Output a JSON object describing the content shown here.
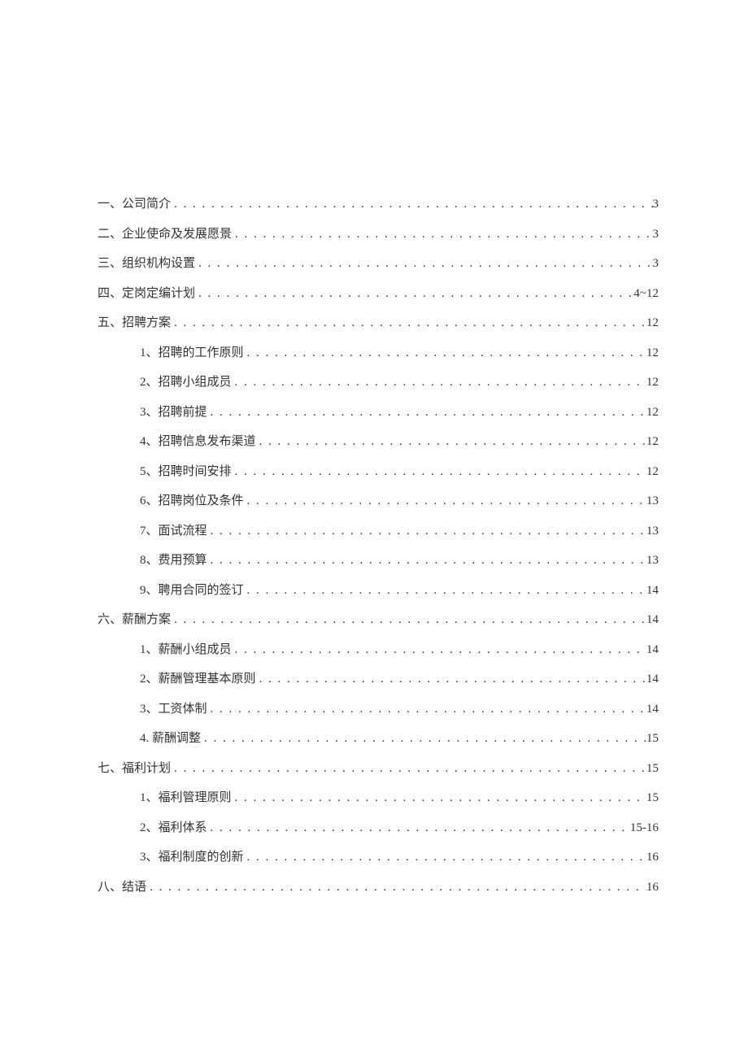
{
  "toc": [
    {
      "level": 1,
      "label": "一、公司简介",
      "page": "3"
    },
    {
      "level": 1,
      "label": "二、企业使命及发展愿景",
      "page": "3"
    },
    {
      "level": 1,
      "label": "三、组织机构设置",
      "page": "3"
    },
    {
      "level": 1,
      "label": "四、定岗定编计划",
      "page": "4~12"
    },
    {
      "level": 1,
      "label": "五、招聘方案",
      "page": "12"
    },
    {
      "level": 2,
      "label": "1、招聘的工作原则",
      "page": "12"
    },
    {
      "level": 2,
      "label": "2、招聘小组成员",
      "page": "12"
    },
    {
      "level": 2,
      "label": "3、招聘前提",
      "page": "12"
    },
    {
      "level": 2,
      "label": "4、招聘信息发布渠道",
      "page": "12"
    },
    {
      "level": 2,
      "label": "5、招聘时间安排",
      "page": "12"
    },
    {
      "level": 2,
      "label": "6、招聘岗位及条件",
      "page": "13"
    },
    {
      "level": 2,
      "label": "7、面试流程",
      "page": "13"
    },
    {
      "level": 2,
      "label": "8、费用预算",
      "page": "13"
    },
    {
      "level": 2,
      "label": "9、聘用合同的签订",
      "page": "14"
    },
    {
      "level": 1,
      "label": "六、薪酬方案",
      "page": "14"
    },
    {
      "level": 2,
      "label": "1、薪酬小组成员",
      "page": "14"
    },
    {
      "level": 2,
      "label": "2、薪酬管理基本原则",
      "page": "14"
    },
    {
      "level": 2,
      "label": "3、工资体制",
      "page": "14"
    },
    {
      "level": 2,
      "label": "4. 薪酬调整",
      "page": "15"
    },
    {
      "level": 1,
      "label": "七、福利计划",
      "page": "15"
    },
    {
      "level": 2,
      "label": "1、福利管理原则",
      "page": "15"
    },
    {
      "level": 2,
      "label": "2、福利体系",
      "page": "15-16"
    },
    {
      "level": 2,
      "label": "3、福利制度的创新",
      "page": "16"
    },
    {
      "level": 1,
      "label": "八、结语",
      "page": "16"
    }
  ]
}
